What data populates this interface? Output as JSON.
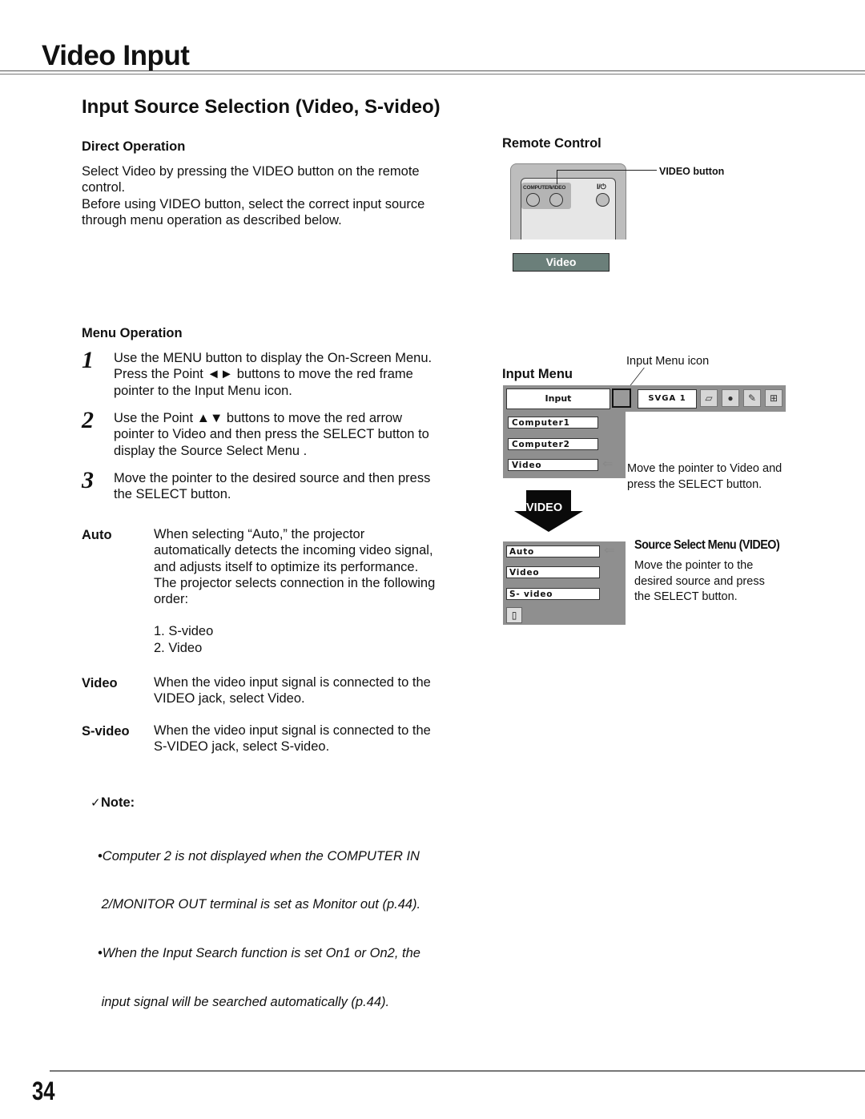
{
  "page": {
    "title": "Video Input",
    "section_title": "Input Source Selection (Video, S-video)",
    "page_number": "34"
  },
  "direct_operation": {
    "heading": "Direct Operation",
    "paragraph1_line1": "Select Video by pressing the VIDEO button on the remote",
    "paragraph1_line2": "control.",
    "paragraph2_line1": "Before using VIDEO button, select the correct input source",
    "paragraph2_line2": "through menu operation as described below."
  },
  "remote_control": {
    "heading": "Remote Control",
    "button_group_labels": [
      "COMPUTER",
      "VIDEO"
    ],
    "power_label": "I/⏻",
    "callout": "VIDEO button",
    "banner": "Video"
  },
  "menu_operation": {
    "heading": "Menu Operation",
    "steps": [
      {
        "number": "1",
        "lines": [
          "Use the MENU button to display the On-Screen Menu.",
          "Press the Point ◄► buttons to move the red frame",
          "pointer to the Input Menu icon."
        ]
      },
      {
        "number": "2",
        "lines": [
          "Use the Point ▲▼ buttons to move the red arrow",
          "pointer to Video and then press the SELECT button to",
          "display the Source Select Menu ."
        ]
      },
      {
        "number": "3",
        "lines": [
          "Move the pointer to the desired source and then press",
          "the SELECT button."
        ]
      }
    ]
  },
  "definitions": [
    {
      "term": "Auto",
      "lines": [
        "When selecting “Auto,” the projector",
        "automatically detects the incoming video signal,",
        "and adjusts itself to optimize its performance.",
        "The projector selects connection in the following",
        "order:"
      ],
      "order": [
        "1. S-video",
        "2. Video"
      ]
    },
    {
      "term": "Video",
      "lines": [
        "When the video input signal is connected to the",
        "VIDEO jack, select Video."
      ]
    },
    {
      "term": "S-video",
      "lines": [
        "When the video input signal is connected to the",
        "S-VIDEO jack, select S-video."
      ]
    }
  ],
  "note": {
    "heading": "Note:",
    "check_icon": "✓",
    "lines": [
      "•Computer 2 is not displayed when the COMPUTER IN",
      " 2/MONITOR OUT terminal is set as Monitor out (p.44).",
      "•When the Input Search function is set On1 or On2, the",
      " input signal will be searched automatically (p.44)."
    ]
  },
  "input_menu": {
    "heading": "Input Menu",
    "icon_callout": "Input Menu icon",
    "menu_title": "Input",
    "signal": "SVGA 1",
    "items": [
      "Computer1",
      "Computer2",
      "Video"
    ],
    "selected_item": "Video",
    "caption_line1": "Move the pointer to Video and",
    "caption_line2": "press the SELECT button."
  },
  "arrow_label": "VIDEO",
  "source_select_menu": {
    "title": "Source Select Menu (VIDEO)",
    "items": [
      "Auto",
      "Video",
      "S- video"
    ],
    "selected_item": "Auto",
    "caption_lines": [
      "Move the pointer to the",
      "desired source and press",
      "the SELECT button."
    ]
  }
}
